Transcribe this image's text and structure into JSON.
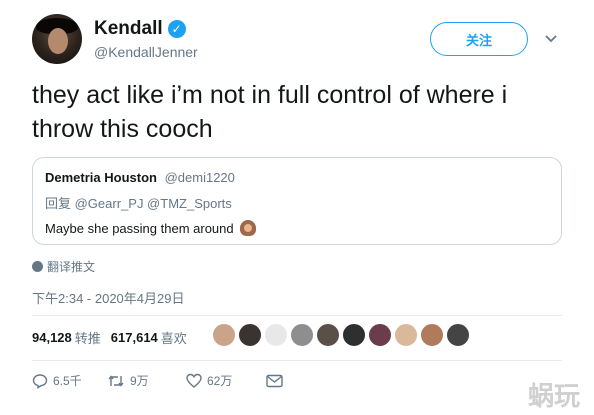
{
  "author": {
    "display_name": "Kendall",
    "handle": "@KendallJenner",
    "verified_mark": "✓"
  },
  "follow_button": {
    "label": "关注"
  },
  "tweet": {
    "text": "they act like i’m not in full control of where i throw this cooch"
  },
  "quoted_tweet": {
    "display_name": "Demetria Houston",
    "handle": "@demi1220",
    "reply_line": "回复 @Gearr_PJ @TMZ_Sports",
    "text": "Maybe she passing them around",
    "emoji": "person-gesturing-emoji"
  },
  "translate_label": "翻译推文",
  "timestamp": "下午2:34 - 2020年4月29日",
  "stats": {
    "retweets_count": "94,128",
    "retweets_label": "转推",
    "likes_count": "617,614",
    "likes_label": "喜欢"
  },
  "liker_avatar_colors": [
    "#c9a48a",
    "#3a3330",
    "#e8e8e8",
    "#8e8e8e",
    "#5b5048",
    "#2f2f2f",
    "#6b3d4a",
    "#d9b99a",
    "#b07a5c",
    "#444444"
  ],
  "actions": {
    "reply_count": "6.5千",
    "retweet_count": "9万",
    "like_count": "62万"
  },
  "watermark": "蜗玩",
  "colors": {
    "accent": "#1da1f2",
    "secondary_text": "#657786",
    "border": "#ccd6dd"
  }
}
